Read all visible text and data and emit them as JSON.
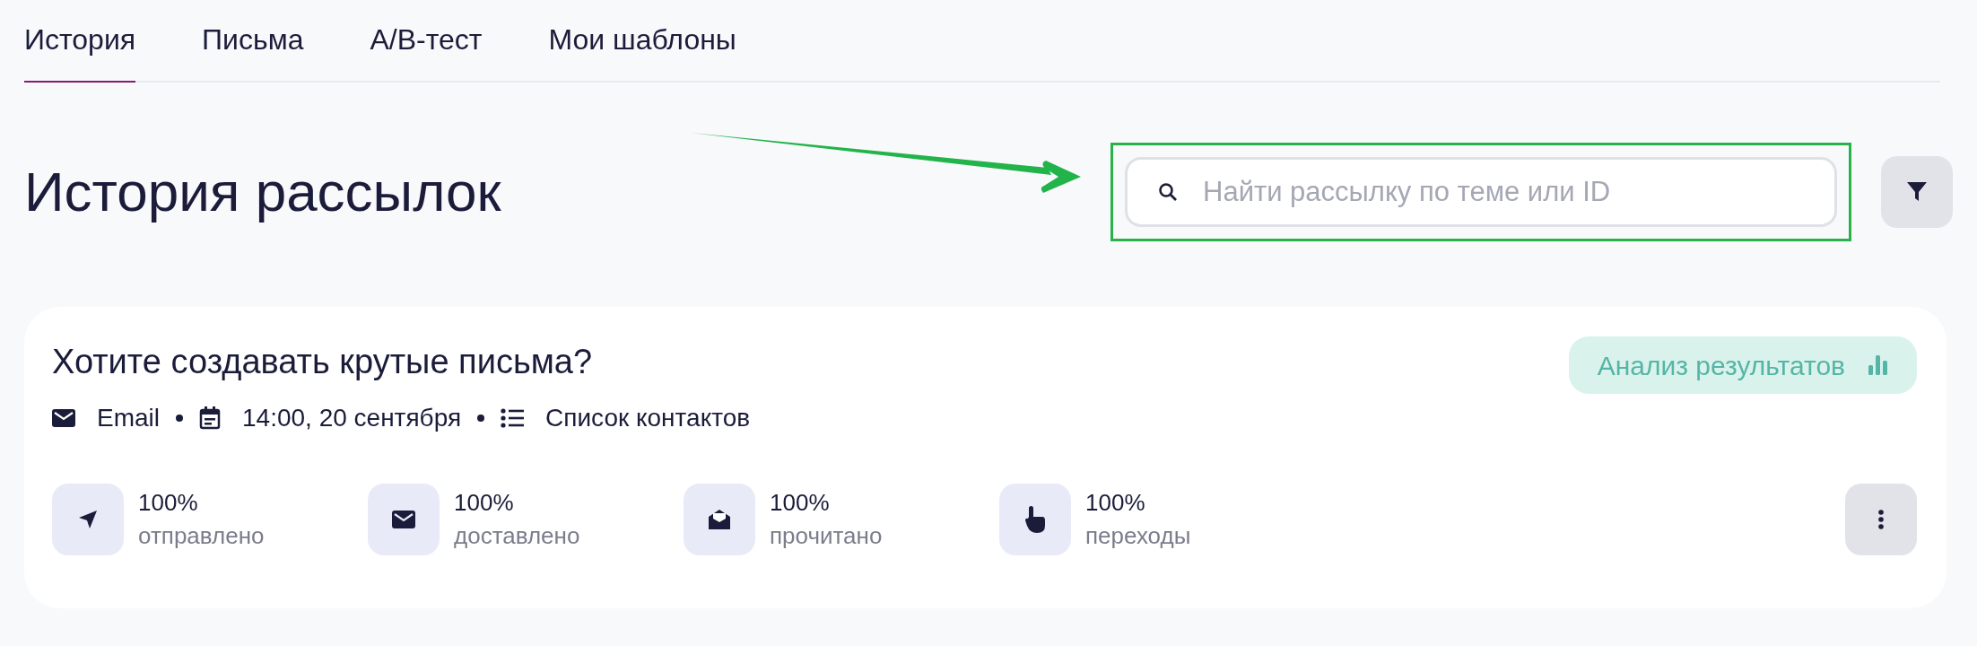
{
  "tabs": [
    {
      "label": "История",
      "selected": true
    },
    {
      "label": "Письма",
      "selected": false
    },
    {
      "label": "A/B-тест",
      "selected": false
    },
    {
      "label": "Мои шаблоны",
      "selected": false
    }
  ],
  "page_title": "История рассылок",
  "search": {
    "placeholder": "Найти рассылку по теме или ID"
  },
  "campaign": {
    "title": "Хотите создавать крутые письма?",
    "meta": [
      {
        "kind": "mail",
        "text": "Email"
      },
      {
        "kind": "calendar",
        "text": "14:00, 20 сентября"
      },
      {
        "kind": "list",
        "text": "Список контактов"
      }
    ],
    "analysis_button": "Анализ результатов",
    "stats": [
      {
        "kind": "sent",
        "value": "100%",
        "label": "отправлено"
      },
      {
        "kind": "delivered",
        "value": "100%",
        "label": "доставлено"
      },
      {
        "kind": "read",
        "value": "100%",
        "label": "прочитано"
      },
      {
        "kind": "clicks",
        "value": "100%",
        "label": "переходы"
      }
    ]
  }
}
